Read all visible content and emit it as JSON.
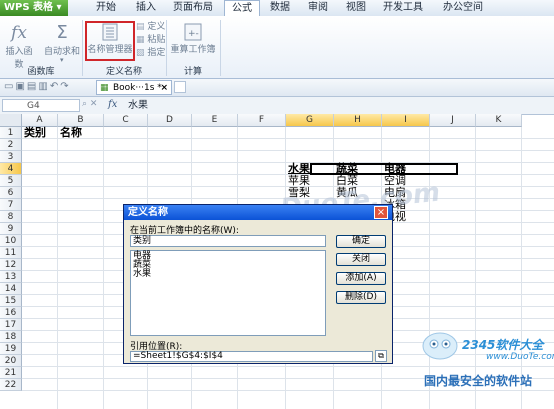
{
  "app": {
    "name": "WPS 表格"
  },
  "menu": {
    "tabs": [
      "开始",
      "插入",
      "页面布局",
      "公式",
      "数据",
      "审阅",
      "视图",
      "开发工具",
      "办公空间"
    ],
    "active": "公式"
  },
  "ribbon": {
    "insert_function": "插入函数",
    "autosum": "自动求和",
    "name_manager": "名称管理器",
    "define": "定义",
    "paste": "粘贴",
    "specify": "指定",
    "recalc": "重算工作簿",
    "group_function_lib": "函数库",
    "group_define_name": "定义名称",
    "group_calc": "计算"
  },
  "doc_tab": {
    "label": "Book···1s *",
    "close": "×"
  },
  "formula_bar": {
    "name_box": "G4",
    "fx": "fx",
    "formula": "水果"
  },
  "grid": {
    "columns": [
      "A",
      "B",
      "C",
      "D",
      "E",
      "F",
      "G",
      "H",
      "I",
      "J",
      "K"
    ],
    "selected_columns": [
      "G",
      "H",
      "I"
    ],
    "rows": [
      "1",
      "2",
      "3",
      "4",
      "5",
      "6",
      "7",
      "8",
      "9",
      "10",
      "11",
      "12",
      "13",
      "14",
      "15",
      "16",
      "17",
      "18",
      "19",
      "20",
      "21",
      "22"
    ],
    "selected_row": "4",
    "cells": {
      "A1": "类别",
      "B1": "名称",
      "G4": "水果",
      "H4": "蔬菜",
      "I4": "电器",
      "G5": "苹果",
      "H5": "白菜",
      "I5": "空调",
      "G6": "雪梨",
      "H6": "黄瓜",
      "I6": "电扇",
      "I7": "冰箱",
      "I8": "电视"
    }
  },
  "dialog": {
    "title": "定义名称",
    "close": "×",
    "names_label": "在当前工作簿中的名称(W):",
    "name_value": "类别",
    "list_items": [
      "电器",
      "蔬菜",
      "水果"
    ],
    "ok": "确定",
    "close_btn": "关闭",
    "add": "添加(A)",
    "delete": "删除(D)",
    "refers_label": "引用位置(R):",
    "refers_value": "=Sheet1!$G$4:$I$4"
  },
  "watermarks": {
    "top": "www.DuoTe.com",
    "site_logo": "2345软件大全",
    "site_url": "www.DuoTe.com",
    "slogan": "国内最安全的软件站"
  }
}
